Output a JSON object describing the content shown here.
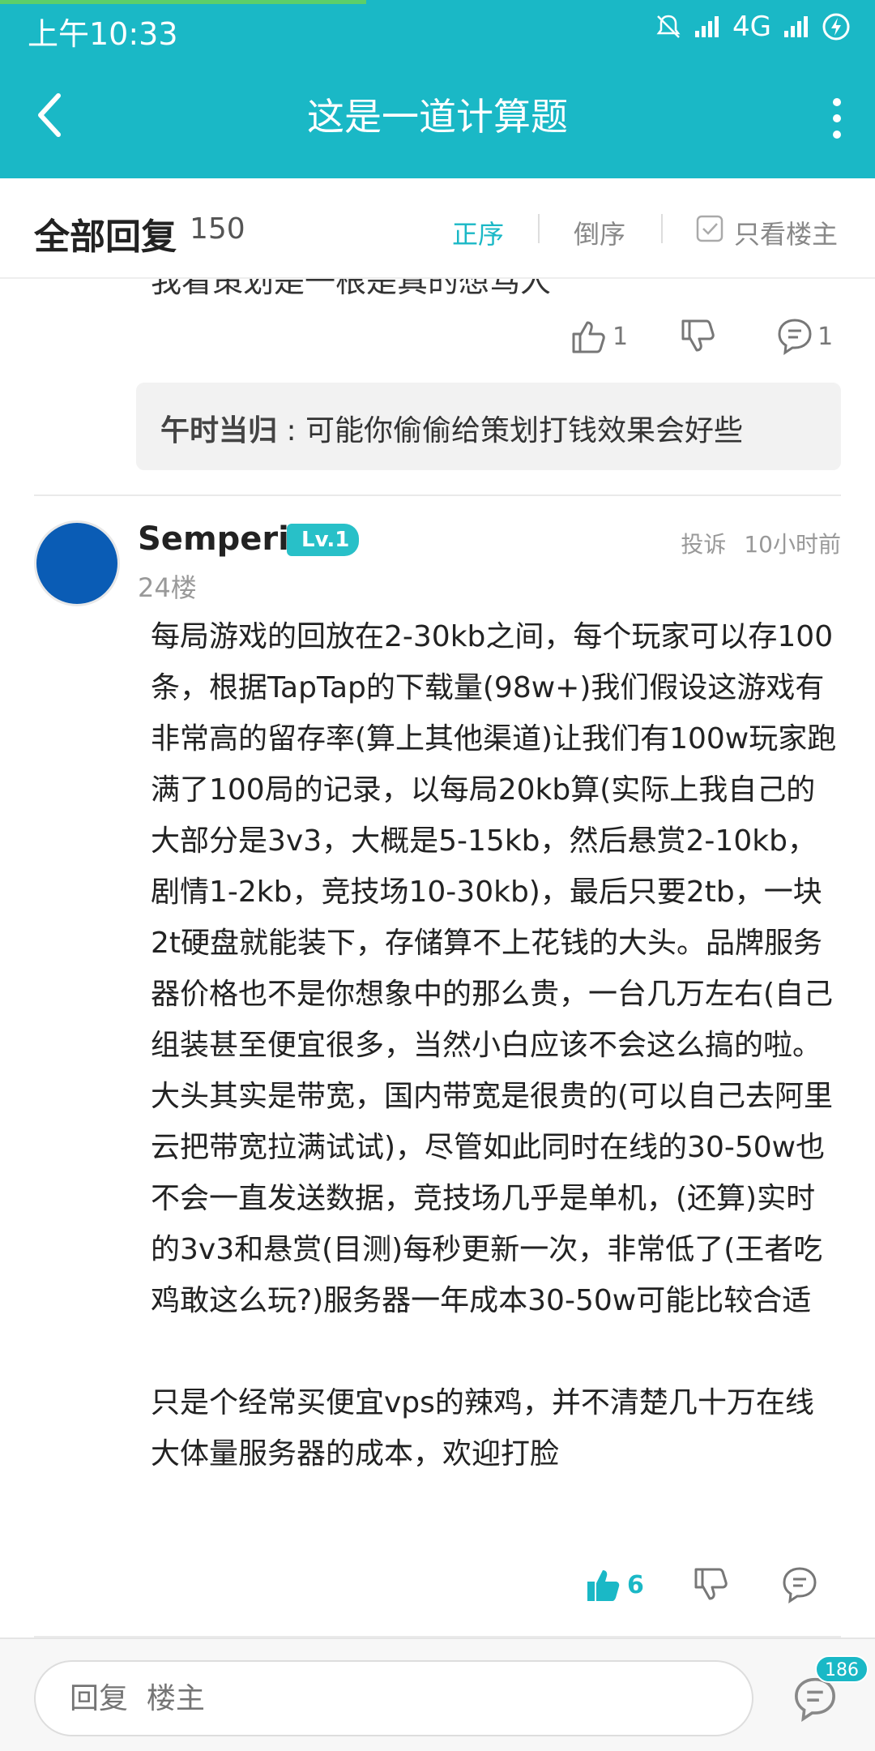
{
  "status_bar": {
    "time": "上午10:33",
    "network": "4G"
  },
  "header": {
    "title": "这是一道计算题"
  },
  "sort_bar": {
    "label": "全部回复",
    "count": "150",
    "options": [
      "正序",
      "倒序"
    ],
    "active": "正序",
    "owner_only": "只看楼主"
  },
  "previous_post": {
    "partial_text": "我看策划是一根是真的想骂人",
    "likes": "1",
    "comments": "1",
    "reply": {
      "author": "午时当归",
      "text": " : 可能你偷偷给策划打钱效果会好些"
    }
  },
  "post": {
    "author": "Semperie",
    "level": "Lv.1",
    "floor": "24楼",
    "report": "投诉",
    "time": "10小时前",
    "paragraphs": [
      "每局游戏的回放在2-30kb之间，每个玩家可以存100条，根据TapTap的下载量(98w+)我们假设这游戏有非常高的留存率(算上其他渠道)让我们有100w玩家跑满了100局的记录，以每局20kb算(实际上我自己的大部分是3v3，大概是5-15kb，然后悬赏2-10kb，剧情1-2kb，竞技场10-30kb)，最后只要2tb，一块2t硬盘就能装下，存储算不上花钱的大头。品牌服务器价格也不是你想象中的那么贵，一台几万左右(自己组装甚至便宜很多，当然小白应该不会这么搞的啦。大头其实是带宽，国内带宽是很贵的(可以自己去阿里云把带宽拉满试试)，尽管如此同时在线的30-50w也不会一直发送数据，竞技场几乎是单机，(还算)实时的3v3和悬赏(目测)每秒更新一次，非常低了(王者吃鸡敢这么玩?)服务器一年成本30-50w可能比较合适",
      "只是个经常买便宜vps的辣鸡，并不清楚几十万在线大体量服务器的成本，欢迎打脸"
    ],
    "likes": "6"
  },
  "bottom_bar": {
    "placeholder": "回复  楼主",
    "comment_count": "186"
  },
  "colors": {
    "accent": "#1ab8c6",
    "progress": "#5ccf6a",
    "avatar": "#0a5cb5"
  },
  "icons": [
    "back-arrow-icon",
    "more-vertical-icon",
    "thumb-up-icon",
    "thumb-down-icon",
    "comment-icon",
    "checkbox-icon",
    "signal-icon",
    "battery-icon",
    "mute-icon"
  ]
}
